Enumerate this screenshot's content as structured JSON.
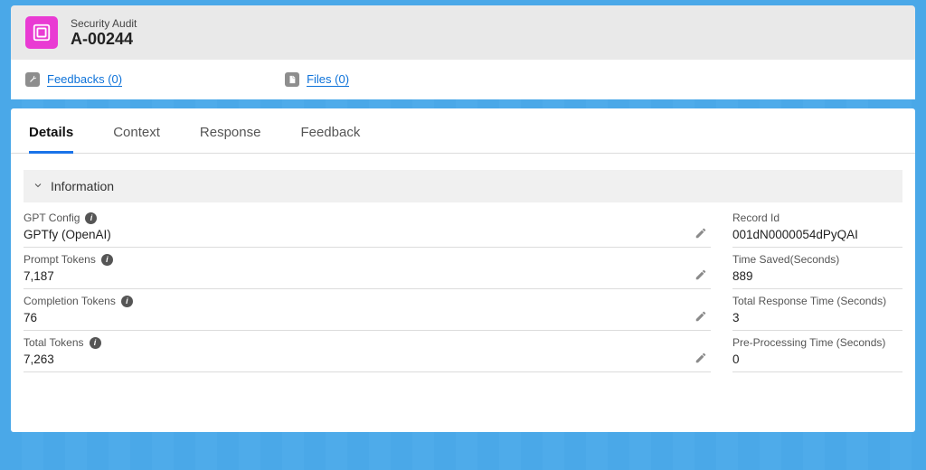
{
  "header": {
    "object_label": "Security Audit",
    "record_number": "A-00244"
  },
  "related": {
    "feedbacks": {
      "label": "Feedbacks (0)"
    },
    "files": {
      "label": "Files (0)"
    }
  },
  "tabs": {
    "details": "Details",
    "context": "Context",
    "response": "Response",
    "feedback": "Feedback"
  },
  "section": {
    "title": "Information"
  },
  "left_fields": {
    "gpt_config": {
      "label": "GPT Config",
      "value": "GPTfy (OpenAI)"
    },
    "prompt_tokens": {
      "label": "Prompt Tokens",
      "value": "7,187"
    },
    "completion_tokens": {
      "label": "Completion Tokens",
      "value": "76"
    },
    "total_tokens": {
      "label": "Total Tokens",
      "value": "7,263"
    }
  },
  "right_fields": {
    "record_id": {
      "label": "Record Id",
      "value": "001dN0000054dPyQAI"
    },
    "time_saved": {
      "label": "Time Saved(Seconds)",
      "value": "889"
    },
    "resp_time": {
      "label": "Total Response Time (Seconds)",
      "value": "3"
    },
    "preproc": {
      "label": "Pre-Processing Time (Seconds)",
      "value": "0"
    }
  }
}
